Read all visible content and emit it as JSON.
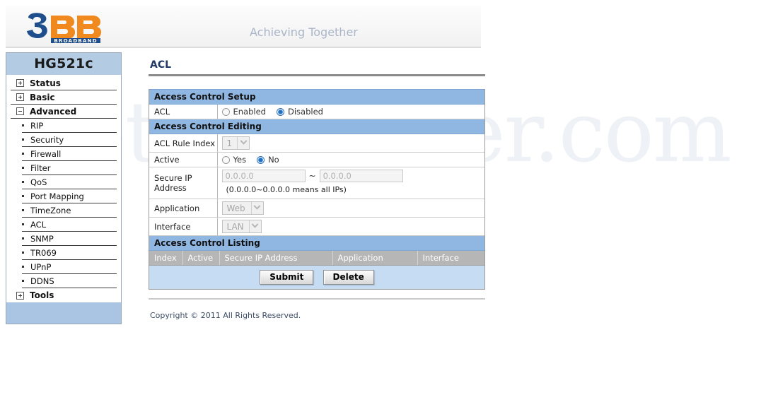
{
  "watermark": "SetupRouter.com",
  "header": {
    "logo_digit": "3",
    "logo_b1": "B",
    "logo_b2": "B",
    "logo_sub": "BROADBAND",
    "tagline": "Achieving Together"
  },
  "sidebar": {
    "device_title": "HG521c",
    "top_items": [
      {
        "label": "Status",
        "expanded": false,
        "icon": "plus-box-icon"
      },
      {
        "label": "Basic",
        "expanded": false,
        "icon": "plus-box-icon"
      },
      {
        "label": "Advanced",
        "expanded": true,
        "icon": "minus-box-icon"
      }
    ],
    "advanced_children": [
      "RIP",
      "Security",
      "Firewall",
      "Filter",
      "QoS",
      "Port Mapping",
      "TimeZone",
      "ACL",
      "SNMP",
      "TR069",
      "UPnP",
      "DDNS"
    ],
    "tools_item": {
      "label": "Tools",
      "expanded": false,
      "icon": "plus-box-icon"
    }
  },
  "main": {
    "page_title": "ACL",
    "setup": {
      "section_title": "Access Control Setup",
      "acl_label": "ACL",
      "options": [
        {
          "label": "Enabled",
          "selected": false
        },
        {
          "label": "Disabled",
          "selected": true
        }
      ]
    },
    "editing": {
      "section_title": "Access Control Editing",
      "rule_index_label": "ACL Rule Index",
      "rule_index_value": "1",
      "active_label": "Active",
      "active_options": [
        {
          "label": "Yes",
          "selected": false
        },
        {
          "label": "No",
          "selected": true
        }
      ],
      "secure_ip_label": "Secure IP Address",
      "secure_ip_from": "0.0.0.0",
      "secure_ip_separator": "~",
      "secure_ip_to": "0.0.0.0",
      "secure_ip_hint": "(0.0.0.0~0.0.0.0 means all IPs)",
      "application_label": "Application",
      "application_value": "Web",
      "interface_label": "Interface",
      "interface_value": "LAN"
    },
    "listing": {
      "section_title": "Access Control Listing",
      "columns": [
        "Index",
        "Active",
        "Secure IP Address",
        "Application",
        "Interface"
      ],
      "rows": []
    },
    "buttons": {
      "submit": "Submit",
      "delete": "Delete"
    },
    "copyright": "Copyright © 2011 All Rights Reserved."
  },
  "colors": {
    "section_header_blue": "#90b7e2",
    "sidebar_title_blue": "#b4cbe4",
    "sidebar_footer_blue": "#a9c5e3",
    "listing_header_grey": "#b6b6b6",
    "button_row_blue": "#c6dcf2",
    "logo_blue": "#1f4e8c",
    "logo_orange": "#f08a1e",
    "title_navy": "#1f3864"
  }
}
